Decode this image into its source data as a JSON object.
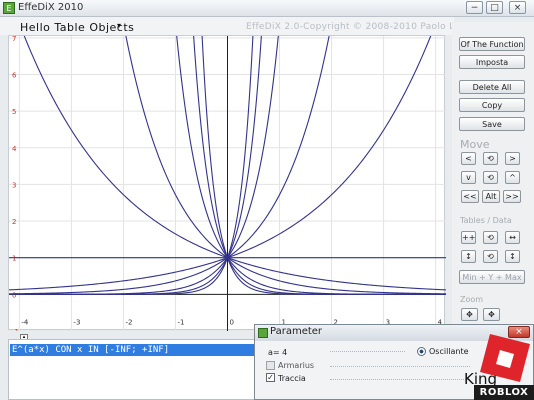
{
  "window": {
    "title": "EffeDiX 2010",
    "buttons": {
      "minimize": "−",
      "maximize": "□",
      "close": "×"
    }
  },
  "toolbar": {
    "menu_label": "Hello Table Objects",
    "menu_arrow": "▾",
    "copyright": "EffeDiX 2.0-Copyright © 2008-2010 Paolo Lazzarini"
  },
  "plot": {
    "x_ticks": [
      "-4",
      "-3",
      "-2",
      "-1",
      "0",
      "1",
      "2",
      "3",
      "4"
    ],
    "y_ticks": [
      "7",
      "6",
      "5",
      "4",
      "3",
      "2",
      "1",
      "0",
      "-1"
    ],
    "grid_color": "#e3e3e3",
    "axis_color": "#222222",
    "curve_color": "#33338a",
    "curve_exponents": [
      0,
      0.5,
      -0.5,
      1,
      -1,
      2,
      -2,
      3,
      -3,
      4,
      -4
    ]
  },
  "right_panel": {
    "function_btn": "Of The Function",
    "imposta_btn": "Imposta",
    "delete_all_btn": "Delete All",
    "copy_btn": "Copy",
    "save_btn": "Save",
    "move_label": "Move",
    "move_buttons": [
      "<",
      "⟲",
      ">",
      "v",
      "⟲",
      "^",
      "<<",
      "Alt",
      ">>"
    ],
    "tables_label": "Tables / Data",
    "table_buttons": [
      "++",
      "⟲",
      "↔",
      "↕",
      "⟲",
      "↕"
    ],
    "min_max_btn": "Min + Y + Max",
    "zoom_label": "Zoom",
    "zoom_buttons": [
      "✥",
      "✥"
    ]
  },
  "expression": {
    "text": "E^(a*x) CON x IN [-INF; +INF]"
  },
  "parameter_window": {
    "title": "Parameter",
    "param_value": "a= 4",
    "oscillante_label": "Oscillante",
    "armarius_label": "Armarius",
    "traccia_label": "Traccia",
    "traccia_checked": true,
    "close_label": "×"
  },
  "watermark": {
    "king_text": "King",
    "roblox_text": "ROBLOX"
  }
}
